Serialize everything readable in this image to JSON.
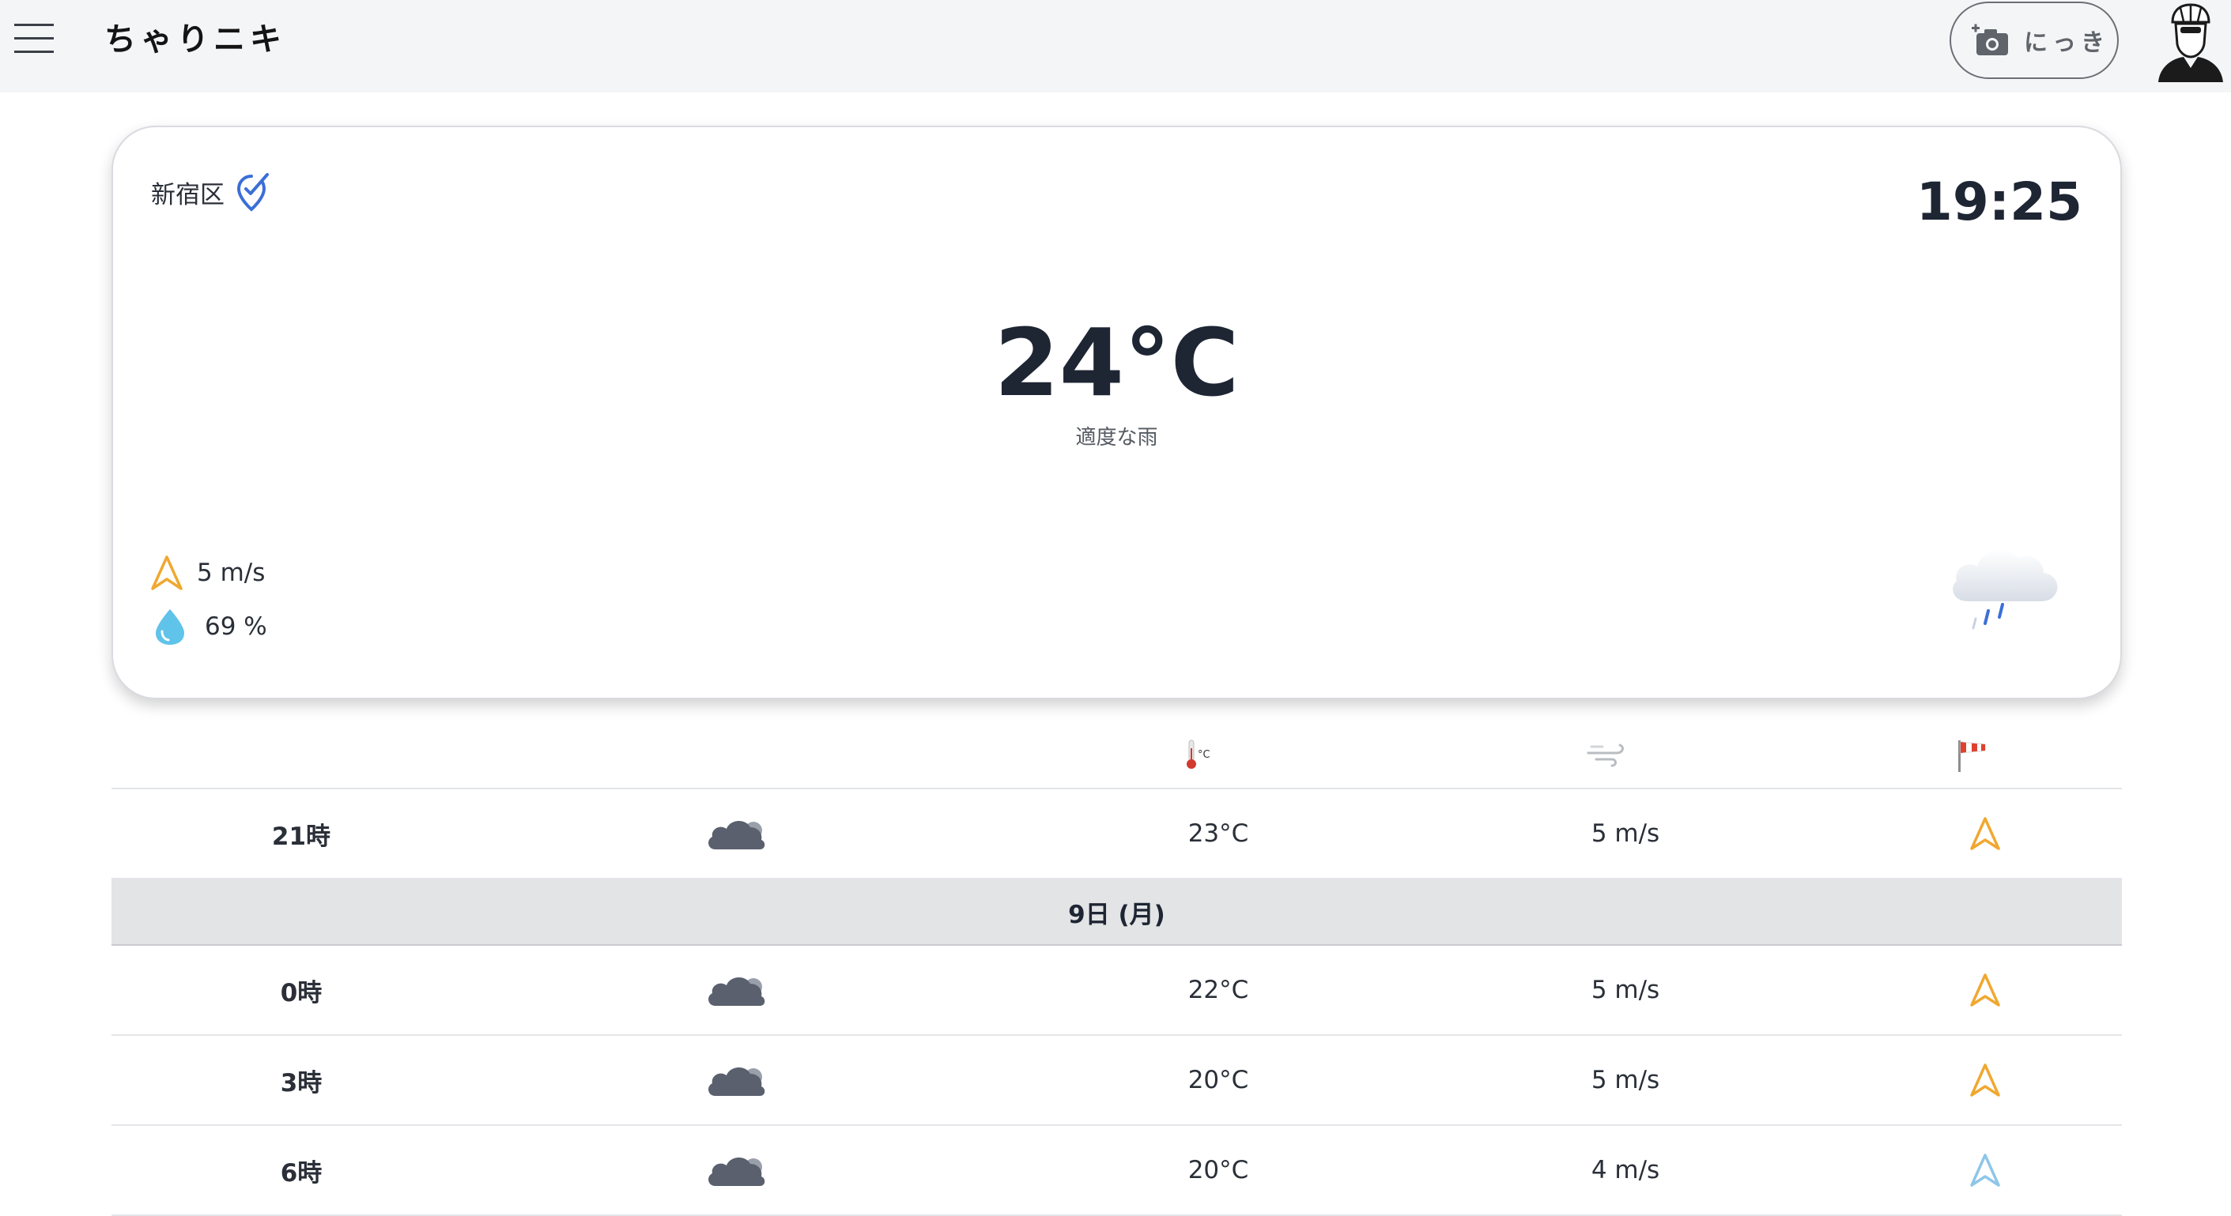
{
  "header": {
    "brand": "ちゃりニキ",
    "diary_button_label": "にっき"
  },
  "current": {
    "location": "新宿区",
    "time": "19:25",
    "temperature": "24°C",
    "description": "適度な雨",
    "wind": "5 m/s",
    "humidity": "69 %"
  },
  "forecast": {
    "rows_before": [
      {
        "hour": "21時",
        "temp": "23°C",
        "wind": "5 m/s",
        "dir_color": "#f0a830"
      }
    ],
    "day_label": "9日 (月)",
    "rows_after": [
      {
        "hour": "0時",
        "temp": "22°C",
        "wind": "5 m/s",
        "dir_color": "#f0a830"
      },
      {
        "hour": "3時",
        "temp": "20°C",
        "wind": "5 m/s",
        "dir_color": "#f0a830"
      },
      {
        "hour": "6時",
        "temp": "20°C",
        "wind": "4 m/s",
        "dir_color": "#8ec6e8"
      }
    ]
  },
  "colors": {
    "accent_blue": "#3b6fd8",
    "wind_warn": "#f0a830",
    "wind_calm": "#8ec6e8",
    "drop": "#5fc3ea"
  },
  "icons": {
    "menu": "hamburger-menu-icon",
    "camera": "camera-plus-icon",
    "avatar": "cyclist-helmet-avatar-icon",
    "location": "location-pin-check-icon",
    "wind": "wind-direction-arrow-icon",
    "humidity": "water-drop-icon",
    "weather": "rain-cloud-icon",
    "forecast_weather": "dark-cloud-icon",
    "col_temp": "thermometer-icon",
    "col_wind": "wind-gust-icon",
    "col_dir": "windsock-flag-icon"
  }
}
